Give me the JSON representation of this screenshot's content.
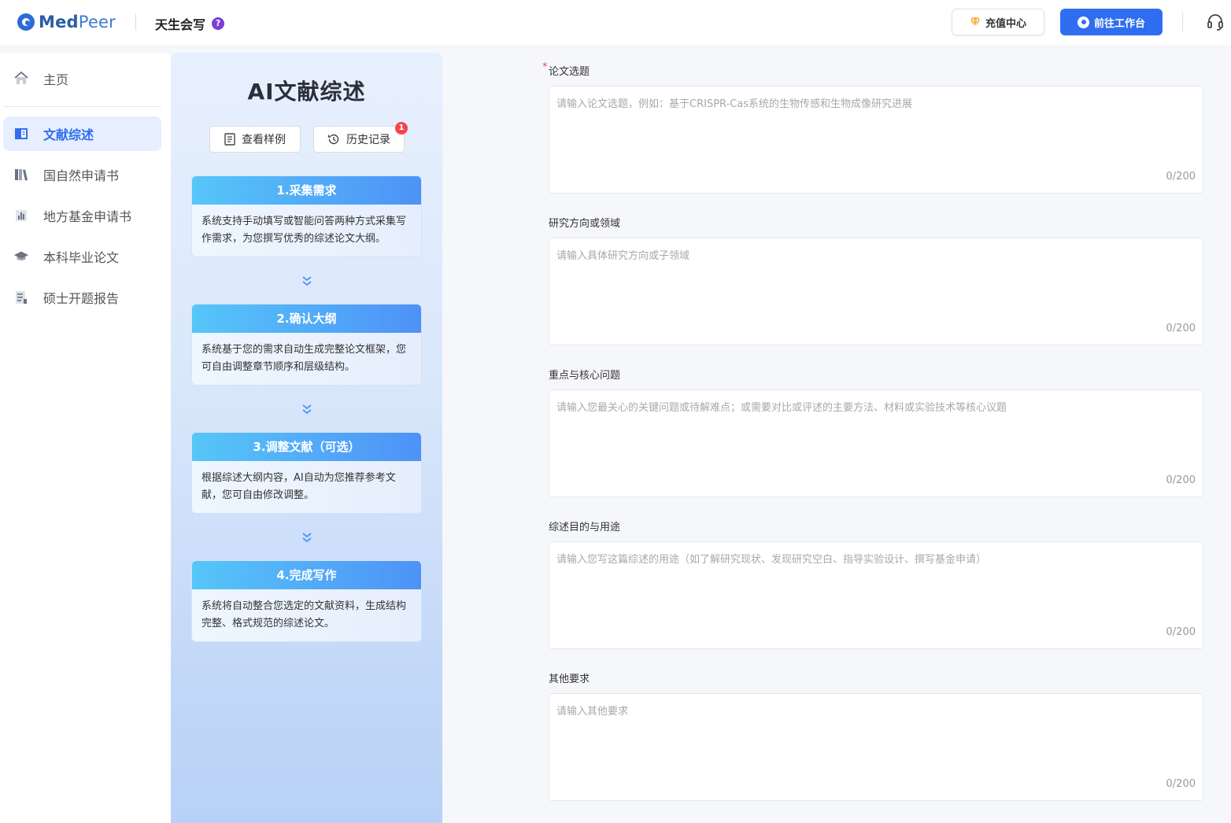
{
  "header": {
    "logo_bold": "Med",
    "logo_light": "Peer",
    "brand": "天生会写",
    "help": "?",
    "recharge_label": "充值中心",
    "workbench_label": "前往工作台"
  },
  "sidebar": {
    "items": [
      {
        "label": "主页",
        "icon": "home-icon"
      },
      {
        "label": "文献综述",
        "icon": "literature-icon",
        "active": true
      },
      {
        "label": "国自然申请书",
        "icon": "books-icon"
      },
      {
        "label": "地方基金申请书",
        "icon": "chart-icon"
      },
      {
        "label": "本科毕业论文",
        "icon": "graduation-cap-icon"
      },
      {
        "label": "硕士开题报告",
        "icon": "report-icon"
      }
    ]
  },
  "panel": {
    "title": "AI文献综述",
    "sample_btn": "查看样例",
    "history_btn": "历史记录",
    "history_badge": "1",
    "steps": [
      {
        "title": "1.采集需求",
        "desc": "系统支持手动填写或智能问答两种方式采集写作需求，为您撰写优秀的综述论文大纲。"
      },
      {
        "title": "2.确认大纲",
        "desc": "系统基于您的需求自动生成完整论文框架，您可自由调整章节顺序和层级结构。"
      },
      {
        "title": "3.调整文献（可选）",
        "desc": "根据综述大纲内容，AI自动为您推荐参考文献，您可自由修改调整。"
      },
      {
        "title": "4.完成写作",
        "desc": "系统将自动整合您选定的文献资料，生成结构完整、格式规范的综述论文。"
      }
    ]
  },
  "form": {
    "fields": [
      {
        "label": "论文选题",
        "required_mark": "*",
        "placeholder": "请输入论文选题，例如：基于CRISPR-Cas系统的生物传感和生物成像研究进展",
        "counter": "0/200"
      },
      {
        "label": "研究方向或领域",
        "placeholder": "请输入具体研究方向或子领域",
        "counter": "0/200"
      },
      {
        "label": "重点与核心问题",
        "placeholder": "请输入您最关心的关键问题或待解难点；或需要对比或评述的主要方法、材料或实验技术等核心议题",
        "counter": "0/200"
      },
      {
        "label": "综述目的与用途",
        "placeholder": "请输入您写这篇综述的用途（如了解研究现状、发现研究空白、指导实验设计、撰写基金申请）",
        "counter": "0/200"
      },
      {
        "label": "其他要求",
        "placeholder": "请输入其他要求",
        "counter": "0/200"
      }
    ]
  },
  "colors": {
    "accent": "#2f6ef0",
    "badge": "#f0474d",
    "required": "#e6474d"
  }
}
